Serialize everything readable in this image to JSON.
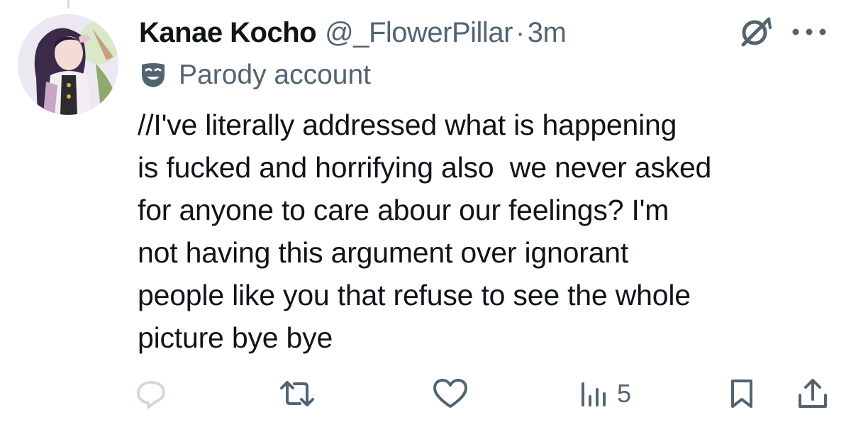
{
  "tweet": {
    "author_name": "Kanae Kocho",
    "handle": "@_FlowerPillar",
    "separator": "·",
    "time": "3m",
    "label": "Parody account",
    "text": "//I've literally addressed what is happening\nis fucked and horrifying also  we never asked\nfor anyone to care abour our feelings? I'm\nnot having this argument over ignorant\npeople like you that refuse to see the whole\npicture bye bye"
  },
  "actions": {
    "views_count": "5"
  },
  "icons": {
    "grok": "grok-icon",
    "more": "more-icon",
    "label": "parody-mask-icon",
    "reply": "reply-icon",
    "retweet": "retweet-icon",
    "like": "like-icon",
    "views": "views-icon",
    "bookmark": "bookmark-icon",
    "share": "share-icon"
  },
  "colors": {
    "text_primary": "#0f1419",
    "text_secondary": "#536471",
    "reply_icon": "#cfd9de"
  }
}
